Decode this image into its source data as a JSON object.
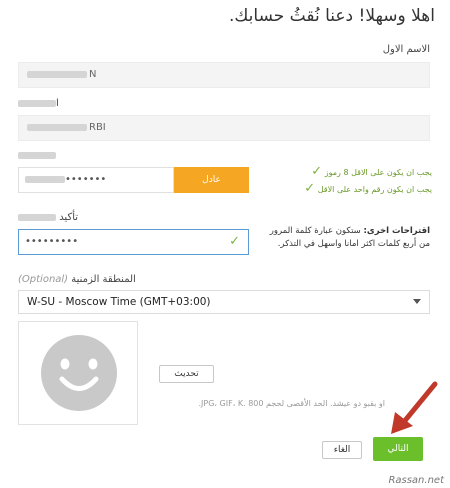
{
  "title": "اهلا وسهلا! دعنا نُقثُ حسابك.",
  "first_name": {
    "label": "الاسم الاول",
    "value": "N"
  },
  "last_name": {
    "label": "ا",
    "value": "RBI"
  },
  "password": {
    "label": "",
    "value": "•••••••",
    "strength": "عادل"
  },
  "password_rules": [
    "يجب ان يكون على الاقل 8 رموز",
    "يجب ان يكون رقم واحد على الاقل"
  ],
  "confirm_password": {
    "label": "تأكيد",
    "value": "•••••••••"
  },
  "suggestion": {
    "heading": "اقتراحات اخرى:",
    "text": "ستكون عبارة كلمة المرور من أربع كلمات اكثر امانا واسهل في التذكر."
  },
  "timezone": {
    "label": "المنطقة الزمنية",
    "optional": "(Optional)",
    "value": "W-SU - Moscow Time (GMT+03:00)"
  },
  "avatar": {
    "update_label": "تحديث",
    "note": "او بقبو دو عيشد. الحد الأقصى لحجم 800 .JPG، GIF، K."
  },
  "buttons": {
    "cancel": "الغاء",
    "next": "التالي"
  },
  "watermark": "Rassan.net"
}
